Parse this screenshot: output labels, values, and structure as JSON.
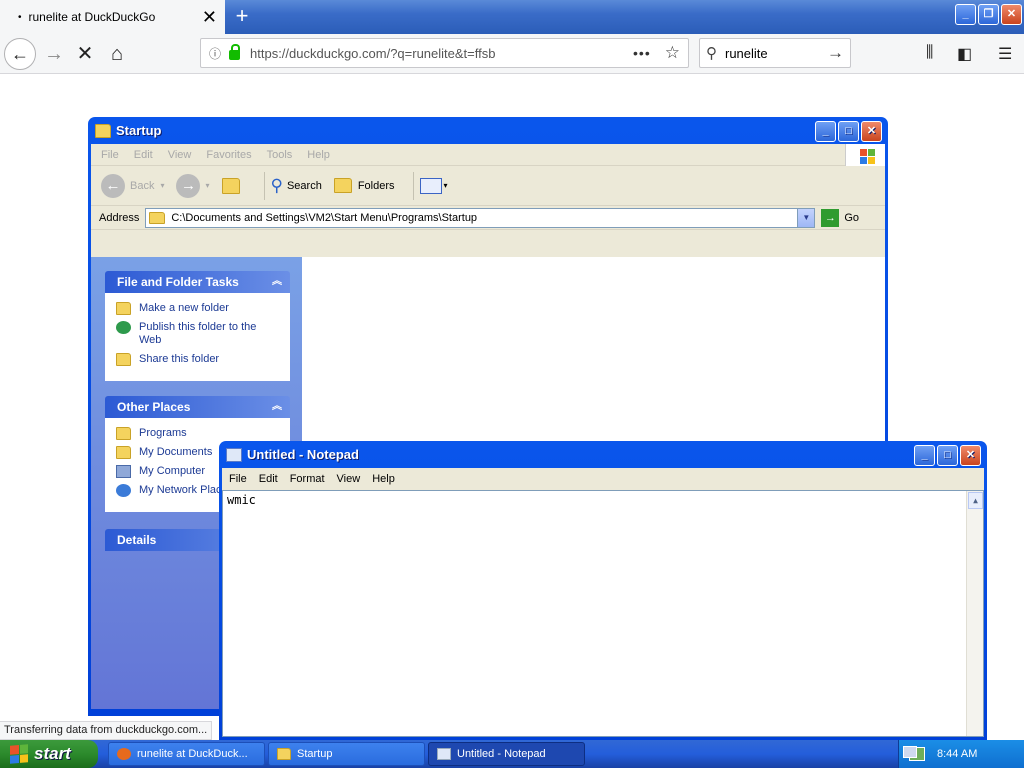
{
  "browser": {
    "tab_title": "runelite at DuckDuckGo",
    "tab_dot": "•",
    "tab_close": "✕",
    "new_tab": "+",
    "url": "https://duckduckgo.com/?q=runelite&t=ffsb",
    "search_query": "runelite",
    "status": "Transferring data from duckduckgo.com..."
  },
  "explorer": {
    "title": "Startup",
    "menu": [
      "File",
      "Edit",
      "View",
      "Favorites",
      "Tools",
      "Help"
    ],
    "toolbar": {
      "back": "Back",
      "search": "Search",
      "folders": "Folders"
    },
    "address_label": "Address",
    "address_value": "C:\\Documents and Settings\\VM2\\Start Menu\\Programs\\Startup",
    "go_label": "Go",
    "tasks_panel": {
      "title": "File and Folder Tasks",
      "items": [
        "Make a new folder",
        "Publish this folder to the Web",
        "Share this folder"
      ]
    },
    "places_panel": {
      "title": "Other Places",
      "items": [
        "Programs",
        "My Documents",
        "My Computer",
        "My Network Places"
      ]
    },
    "details_panel": {
      "title": "Details"
    }
  },
  "notepad": {
    "title": "Untitled - Notepad",
    "menu": [
      "File",
      "Edit",
      "Format",
      "View",
      "Help"
    ],
    "content": "wmic"
  },
  "taskbar": {
    "start_label": "start",
    "tasks": [
      "runelite at DuckDuck...",
      "Startup",
      "Untitled - Notepad"
    ],
    "clock": "8:44 AM"
  },
  "colors": {
    "xp_blue": "#0a56ec",
    "start_green": "#2c8a2c",
    "panel_bg": "#6375d6"
  }
}
